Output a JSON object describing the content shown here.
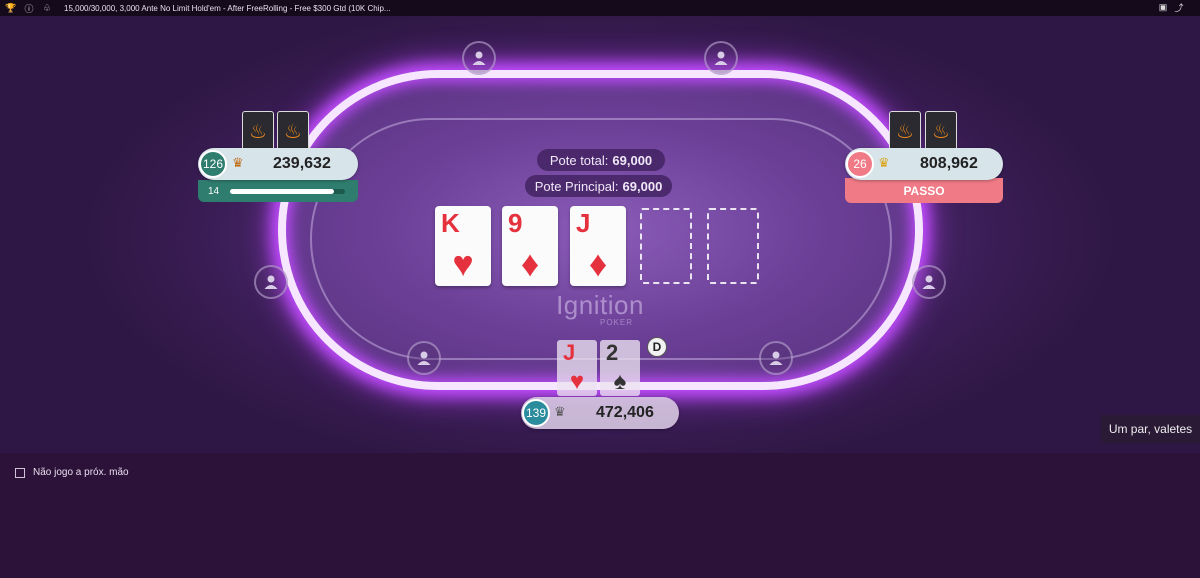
{
  "topbar": {
    "title": "15,000/30,000, 3,000 Ante No Limit Hold'em - After FreeRolling - Free $300 Gtd (10K Chip...",
    "icons": [
      "trophy-icon",
      "info-icon",
      "cards-icon",
      "layout-icon",
      "share-icon"
    ]
  },
  "pot": {
    "total_label": "Pote total:",
    "total_value": "69,000",
    "main_label": "Pote Principal:",
    "main_value": "69,000"
  },
  "board": [
    {
      "rank": "K",
      "suit": "♥"
    },
    {
      "rank": "9",
      "suit": "♦"
    },
    {
      "rank": "J",
      "suit": "♦"
    }
  ],
  "brand": {
    "name": "Ignition",
    "sub": "POKER"
  },
  "players": {
    "left": {
      "level": "126",
      "stack": "239,632",
      "timer_label": "14",
      "timer_fraction": 0.9
    },
    "right": {
      "level": "26",
      "stack": "808,962",
      "action": "PASSO"
    },
    "hero": {
      "level": "139",
      "stack": "472,406",
      "cards": [
        {
          "rank": "J",
          "suit": "♥",
          "color": "#e5313d"
        },
        {
          "rank": "2",
          "suit": "♠",
          "color": "#333333"
        }
      ],
      "dealer": "D"
    }
  },
  "hand_strength": "Um par, valetes",
  "sit_out_label": "Não jogo a próx. mão",
  "colors": {
    "left_level": "#2f7d6e",
    "right_level": "#f07a86",
    "hero_level": "#2a8c9c",
    "accent_neon": "#c24cff"
  }
}
